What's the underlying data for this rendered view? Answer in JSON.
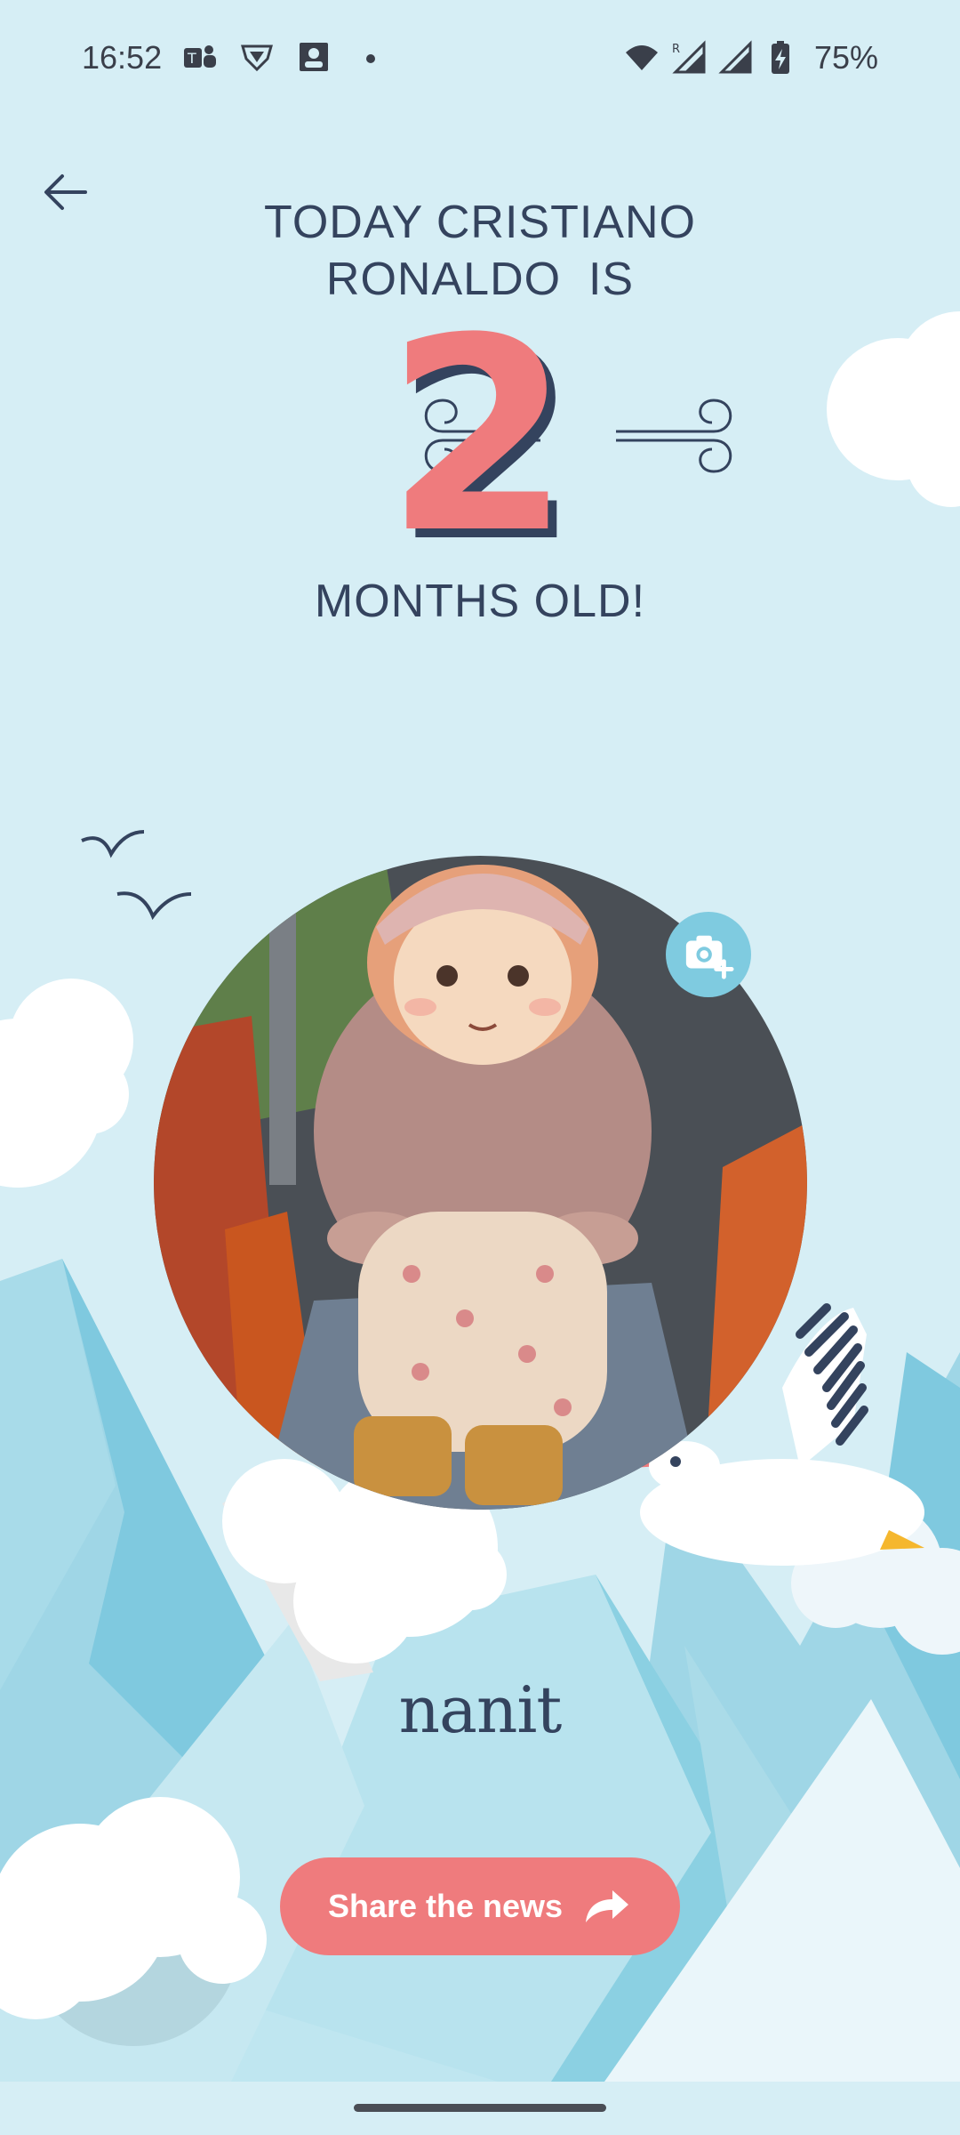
{
  "status_bar": {
    "time": "16:52",
    "left_icons": [
      "teams-icon",
      "vpn-shield-icon",
      "contact-card-icon",
      "notification-dot-icon"
    ],
    "right_icons": [
      "wifi-icon",
      "roaming-signal-icon",
      "signal-icon",
      "battery-charging-icon"
    ],
    "battery": "75%"
  },
  "header": {
    "line1": "TODAY CRISTIANO",
    "line2": "RONALDO  IS",
    "age_number": "2",
    "line3": "MONTHS OLD!"
  },
  "photo": {
    "camera_icon": "camera-add-icon"
  },
  "brand": "nanit",
  "share": {
    "label": "Share the news",
    "icon": "share-arrow-icon"
  },
  "colors": {
    "background": "#d6eef5",
    "accent": "#ef7b7d",
    "text": "#34435e",
    "camera_button": "#7fcbe0"
  }
}
